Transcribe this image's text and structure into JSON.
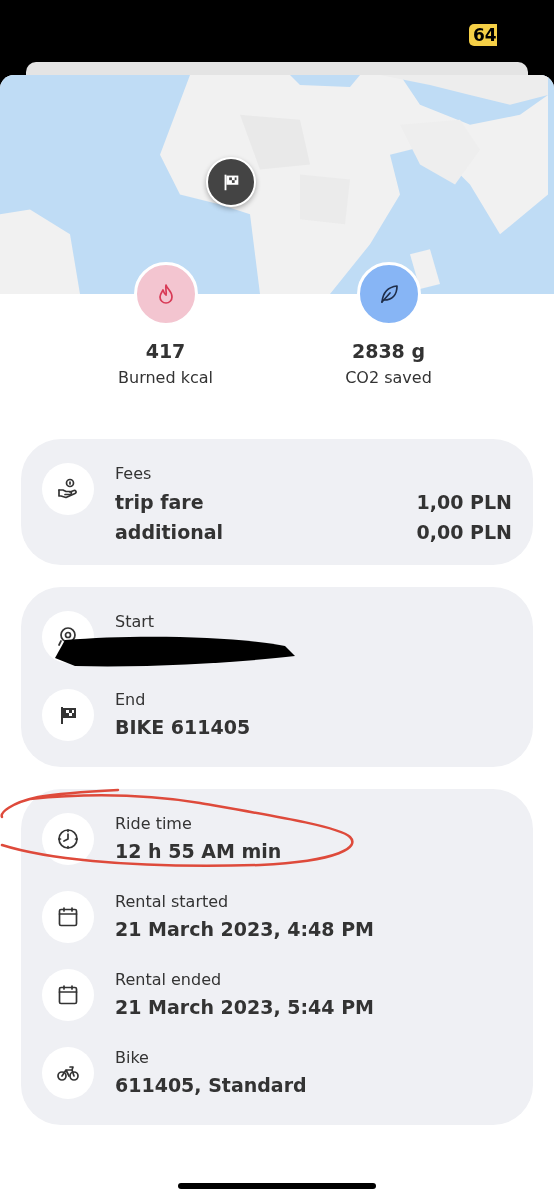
{
  "status_bar": {
    "battery": "64"
  },
  "stats": [
    {
      "kind": "kcal",
      "value": "417",
      "label": "Burned kcal"
    },
    {
      "kind": "co2",
      "value": "2838 g",
      "label": "CO2 saved"
    }
  ],
  "cards": [
    {
      "rows": [
        {
          "kind": "fees",
          "label": "Fees",
          "lines": [
            {
              "name": "trip fare",
              "amount": "1,00 PLN"
            },
            {
              "name": "additional",
              "amount": "0,00 PLN"
            }
          ]
        }
      ]
    },
    {
      "rows": [
        {
          "kind": "start",
          "label": "Start",
          "redacted": true
        },
        {
          "kind": "end",
          "label": "End",
          "value": "BIKE 611405"
        }
      ]
    },
    {
      "rows": [
        {
          "kind": "ride_time",
          "label": "Ride time",
          "value": "12 h 55 AM min",
          "highlighted": true
        },
        {
          "kind": "rental_started",
          "label": "Rental started",
          "value": "21 March 2023, 4:48 PM"
        },
        {
          "kind": "rental_ended",
          "label": "Rental ended",
          "value": "21 March 2023, 5:44 PM"
        },
        {
          "kind": "bike",
          "label": "Bike",
          "value": "611405, Standard"
        }
      ]
    }
  ]
}
